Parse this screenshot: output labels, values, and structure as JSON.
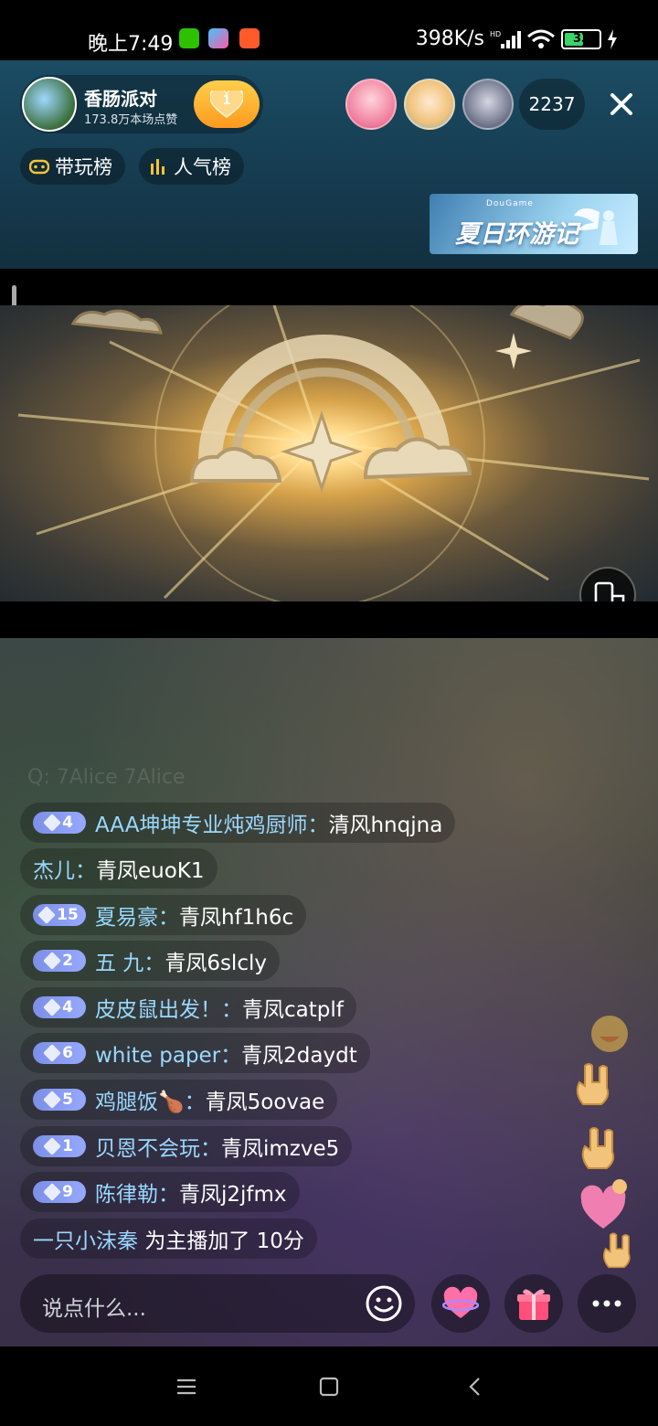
{
  "status_bar": {
    "time": "晚上7:49",
    "net_speed": "398K/s",
    "battery": "33",
    "app_icons": [
      "wechat-icon",
      "play-icon",
      "camera-app-icon"
    ]
  },
  "host": {
    "name": "香肠派对",
    "likes": "173.8万本场点赞",
    "fan_level": "1"
  },
  "viewers": {
    "count": "2237"
  },
  "ranks": {
    "carry": "带玩榜",
    "popularity": "人气榜"
  },
  "banner": {
    "brand": "DouGame",
    "title": "夏日环游记"
  },
  "chat": {
    "faded": "Q: 7Alice 7Alice",
    "messages": [
      {
        "level": "4",
        "user": "AAA坤坤专业炖鸡厨师：",
        "text": "清风hnqjna"
      },
      {
        "level": "",
        "user": "杰儿：",
        "text": "青凤euoK1"
      },
      {
        "level": "15",
        "user": "夏易豪：",
        "text": "青凤hf1h6c"
      },
      {
        "level": "2",
        "user": "五 九：",
        "text": "青凤6slcly"
      },
      {
        "level": "4",
        "user": "皮皮鼠出发！：",
        "text": "青凤catplf"
      },
      {
        "level": "6",
        "user": "white paper：",
        "text": "青凤2daydt"
      },
      {
        "level": "5",
        "user": "鸡腿饭🍗：",
        "text": "青凤5oovae"
      },
      {
        "level": "1",
        "user": "贝恩不会玩：",
        "text": "青凤imzve5"
      },
      {
        "level": "9",
        "user": "陈律勒：",
        "text": "青凤j2jfmx"
      }
    ],
    "system": {
      "user": "一只小沫秦",
      "text": "为主播加了 10分"
    }
  },
  "input": {
    "placeholder": "说点什么..."
  },
  "colors": {
    "level_badge": "#8a9df2",
    "username": "#9ad8ff",
    "follow_button": "#ffb52e"
  }
}
